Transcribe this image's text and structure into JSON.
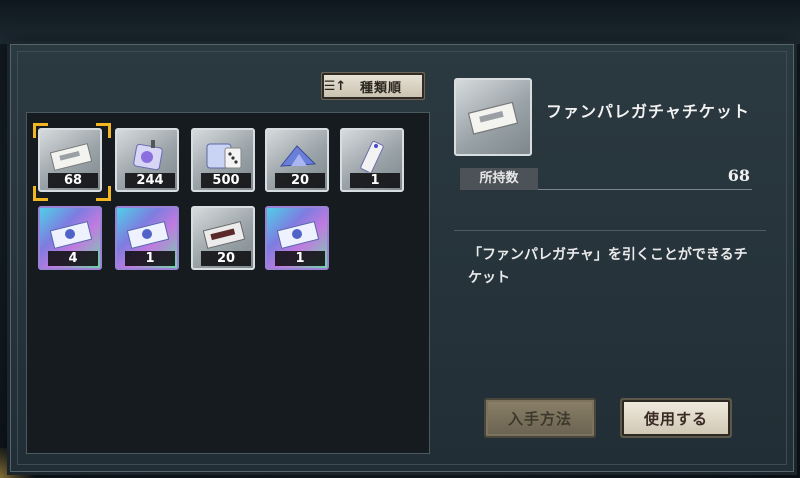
{
  "sort_button": {
    "icon": "sort-icon",
    "label": "種類順"
  },
  "items": [
    {
      "count": "68",
      "kind": "fanpare-ticket",
      "rare": false,
      "selected": true
    },
    {
      "count": "244",
      "kind": "pouch",
      "rare": false,
      "selected": false
    },
    {
      "count": "500",
      "kind": "dice-card",
      "rare": false,
      "selected": false
    },
    {
      "count": "20",
      "kind": "crystal-shards",
      "rare": false,
      "selected": false
    },
    {
      "count": "1",
      "kind": "tag-charm",
      "rare": false,
      "selected": false
    },
    {
      "count": "4",
      "kind": "rainbow-ticket",
      "rare": true,
      "selected": false
    },
    {
      "count": "1",
      "kind": "rainbow-ticket",
      "rare": true,
      "selected": false
    },
    {
      "count": "20",
      "kind": "silver-ticket",
      "rare": false,
      "selected": false
    },
    {
      "count": "1",
      "kind": "rainbow-ticket",
      "rare": true,
      "selected": false
    }
  ],
  "detail": {
    "name": "ファンパレガチャチケット",
    "owned_label": "所持数",
    "owned_value": "68",
    "description": "「ファンパレガチャ」を引くことができるチケット"
  },
  "buttons": {
    "obtain": "入手方法",
    "use": "使用する"
  },
  "colors": {
    "selection": "#f1b622",
    "rare_border": "#9a83d6"
  }
}
